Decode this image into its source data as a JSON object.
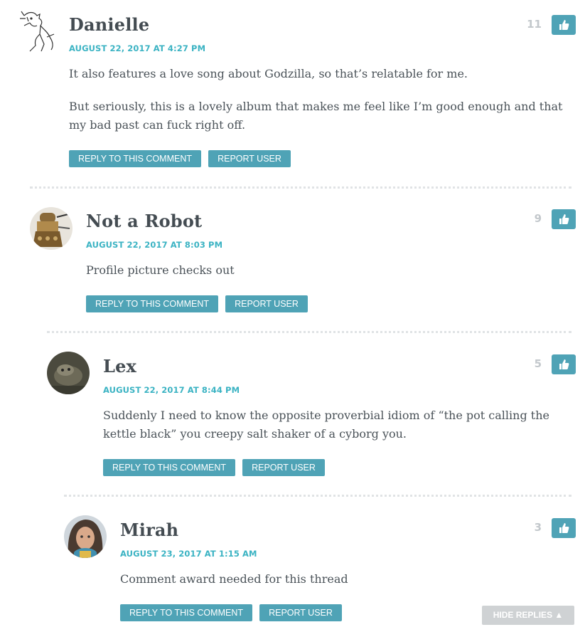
{
  "comments": [
    {
      "author": "Danielle",
      "date": "AUGUST 22, 2017 AT 4:27 PM",
      "paragraphs": [
        "It also features a love song about Godzilla, so that’s relatable for me.",
        "But seriously, this is a lovely album that makes me feel like I’m good enough and that my bad past can fuck right off."
      ],
      "likes": "11",
      "reply_label": "REPLY TO THIS COMMENT",
      "report_label": "REPORT USER"
    },
    {
      "author": "Not a Robot",
      "date": "AUGUST 22, 2017 AT 8:03 PM",
      "paragraphs": [
        "Profile picture checks out"
      ],
      "likes": "9",
      "reply_label": "REPLY TO THIS COMMENT",
      "report_label": "REPORT USER"
    },
    {
      "author": "Lex",
      "date": "AUGUST 22, 2017 AT 8:44 PM",
      "paragraphs": [
        "Suddenly I need to know the opposite proverbial idiom of “the pot calling the kettle black” you creepy salt shaker of a cyborg you."
      ],
      "likes": "5",
      "reply_label": "REPLY TO THIS COMMENT",
      "report_label": "REPORT USER"
    },
    {
      "author": "Mirah",
      "date": "AUGUST 23, 2017 AT 1:15 AM",
      "paragraphs": [
        "Comment award needed for this thread"
      ],
      "likes": "3",
      "reply_label": "REPLY TO THIS COMMENT",
      "report_label": "REPORT USER"
    }
  ],
  "hide_replies_label": "HIDE REPLIES ▲",
  "colors": {
    "accent": "#4fa3b6",
    "date": "#3bb3c3",
    "author": "#444c52",
    "text": "#4a5258"
  }
}
